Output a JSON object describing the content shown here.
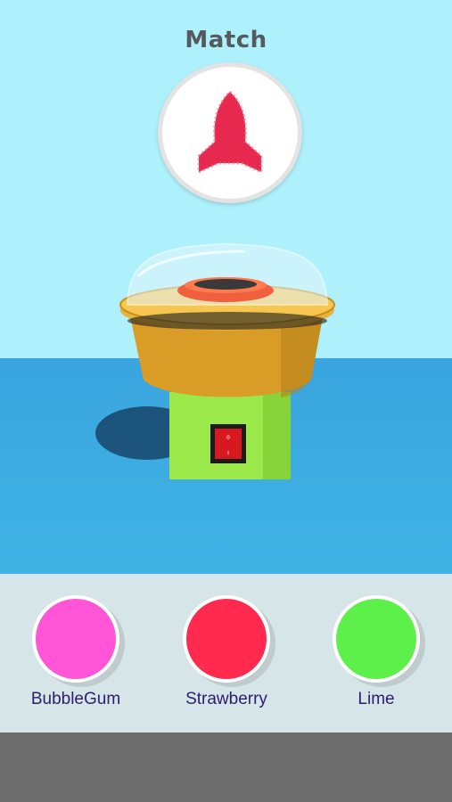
{
  "header": {
    "title": "Match"
  },
  "target": {
    "icon": "rocket-icon",
    "color": "#e8294f"
  },
  "machine": {
    "base_color": "#9be84a",
    "bowl_color": "#d89c27",
    "switch_color": "#d7191f"
  },
  "colors": {
    "sky": "#aef0fb",
    "floor": "#3aa5df",
    "panel": "#d6e6e8",
    "bar": "#6d6d6d"
  },
  "flavors": [
    {
      "label": "BubbleGum",
      "color": "#ff55d6"
    },
    {
      "label": "Strawberry",
      "color": "#ff2a4e"
    },
    {
      "label": "Lime",
      "color": "#5ef04a"
    }
  ]
}
